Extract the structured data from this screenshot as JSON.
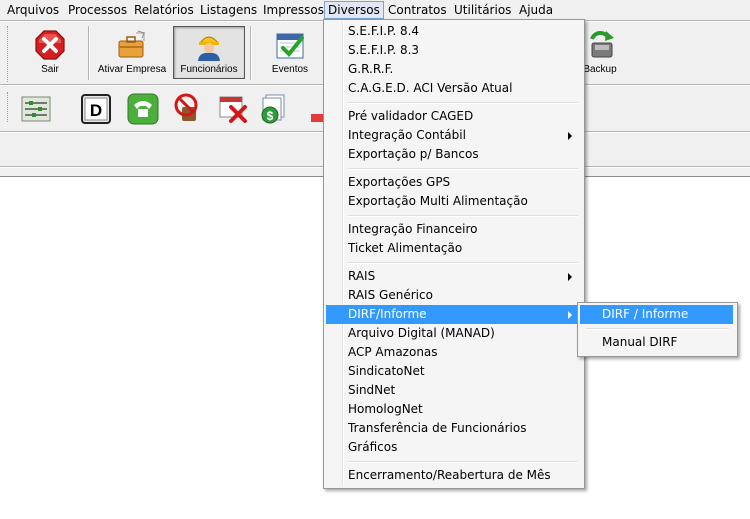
{
  "menubar": {
    "items": [
      "Arquivos",
      "Processos",
      "Relatórios",
      "Listagens",
      "Impressos",
      "Diversos",
      "Contratos",
      "Utilitários",
      "Ajuda"
    ],
    "active": "Diversos"
  },
  "toolbar": {
    "buttons": [
      {
        "label": "Sair",
        "icon": "close-x-icon"
      },
      {
        "label": "Ativar Empresa",
        "icon": "briefcase-icon"
      },
      {
        "label": "Funcionários",
        "icon": "worker-icon",
        "pressed": true
      },
      {
        "label": "Eventos",
        "icon": "calendar-check-icon"
      },
      {
        "label": "Backup",
        "icon": "backup-icon"
      }
    ],
    "small_icons": [
      "sliders-icon",
      "d-key-icon",
      "phone-icon",
      "no-stamp-icon",
      "calendar-cancel-icon",
      "money-icon",
      "red-icon"
    ]
  },
  "dropdown": {
    "items": [
      {
        "label": "S.E.F.I.P. 8.4"
      },
      {
        "label": "S.E.F.I.P. 8.3"
      },
      {
        "label": "G.R.R.F."
      },
      {
        "label": "C.A.G.E.D. ACI Versão Atual"
      },
      {
        "label": "Pré validador CAGED"
      },
      {
        "label": "Integração Contábil",
        "submenu": true
      },
      {
        "label": "Exportação p/ Bancos"
      },
      {
        "label": "Exportações GPS"
      },
      {
        "label": "Exportação Multi Alimentação"
      },
      {
        "label": "Integração Financeiro"
      },
      {
        "label": "Ticket Alimentação"
      },
      {
        "label": "RAIS",
        "submenu": true
      },
      {
        "label": "RAIS Genérico"
      },
      {
        "label": "DIRF/Informe",
        "submenu": true,
        "highlighted": true
      },
      {
        "label": "Arquivo Digital (MANAD)"
      },
      {
        "label": "ACP Amazonas"
      },
      {
        "label": "SindicatoNet"
      },
      {
        "label": "SindNet"
      },
      {
        "label": "HomologNet"
      },
      {
        "label": "Transferência de Funcionários"
      },
      {
        "label": "Gráficos"
      },
      {
        "label": "Encerramento/Reabertura de Mês"
      }
    ]
  },
  "submenu": {
    "items": [
      {
        "label": "DIRF / Informe",
        "highlighted": true
      },
      {
        "label": "Manual DIRF"
      }
    ]
  },
  "colors": {
    "highlight": "#3399ff",
    "menubar_bg": "#f0f0f0",
    "menu_bg": "#f5f5f5"
  }
}
